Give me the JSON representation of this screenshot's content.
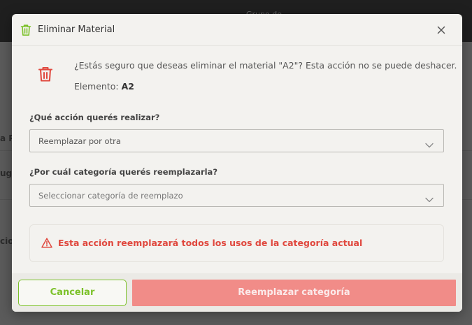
{
  "background": {
    "title_fragment": "Grupo de...",
    "row_fragments": [
      "a Po",
      "ug",
      "cio"
    ]
  },
  "modal": {
    "title": "Eliminar Material",
    "header_icon": "trash-icon",
    "close_icon": "close-icon",
    "confirm_message": "¿Estás seguro que deseas eliminar el material \"A2\"? Esta acción no se puede deshacer.",
    "element_label": "Elemento:",
    "element_value": "A2",
    "action_field": {
      "label": "¿Qué acción querés realizar?",
      "value": "Reemplazar por otra"
    },
    "category_field": {
      "label": "¿Por cuál categoría querés reemplazarla?",
      "placeholder": "Seleccionar categoría de reemplazo"
    },
    "alert": {
      "icon": "warning-icon",
      "text": "Esta acción reemplazará todos los usos de la categoría actual"
    },
    "footer": {
      "cancel_label": "Cancelar",
      "confirm_label": "Reemplazar categoría"
    }
  },
  "colors": {
    "accent_green": "#7cc12a",
    "danger_red": "#e0483e",
    "danger_button": "#f18c88"
  }
}
